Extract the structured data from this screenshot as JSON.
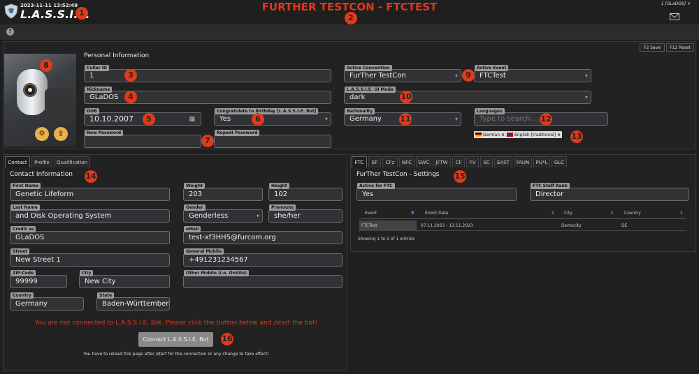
{
  "header": {
    "timestamp": "2023-11-11 13:52:49",
    "logo_text": "L.A.S.S.I.E.",
    "title": "FURTHER TESTCON - FTCTEST",
    "user": "1 [GLaDOS]",
    "logout_glyph": "×"
  },
  "toolbar": {
    "help": "?",
    "save": "F2 Save",
    "reset": "F12 Reset"
  },
  "personal": {
    "heading": "Personal Information",
    "collar_id": {
      "label": "Collar ID",
      "value": "1"
    },
    "nickname": {
      "label": "Nickname",
      "value": "GLaDOS"
    },
    "dob": {
      "label": "DOB",
      "value": "10.10.2007"
    },
    "birthday": {
      "label": "Congratulate to birthday [L.A.S.S.I.E. Bot]",
      "value": "Yes"
    },
    "new_password": {
      "label": "New Password",
      "value": ""
    },
    "repeat_password": {
      "label": "Repeat Password",
      "value": ""
    },
    "active_convention": {
      "label": "Active Convention",
      "value": "FurTher TestCon"
    },
    "active_event": {
      "label": "Active Event",
      "value": "FTCTest"
    },
    "ui_mode": {
      "label": "L.A.S.S.I.E. UI Mode",
      "value": "dark"
    },
    "nationality": {
      "label": "Nationality",
      "value": "Germany"
    },
    "languages": {
      "label": "Languages",
      "placeholder": "Type to search ...",
      "tags": [
        "German",
        "English [traditional]"
      ],
      "remove_glyph": "×"
    }
  },
  "contact": {
    "tabs": [
      "Contact",
      "Profile",
      "Qualification"
    ],
    "heading": "Contact Information",
    "first_name": {
      "label": "First Name",
      "value": "Genetic Lifeform"
    },
    "weight": {
      "label": "Weight",
      "value": "203"
    },
    "height": {
      "label": "Height",
      "value": "102"
    },
    "last_name": {
      "label": "Last Name",
      "value": "and Disk Operating System"
    },
    "gender": {
      "label": "Gender",
      "value": "Genderless"
    },
    "pronouns": {
      "label": "Pronouns",
      "value": "she/her"
    },
    "credit_as": {
      "label": "Credit as",
      "value": "GLaDOS"
    },
    "email": {
      "label": "eMail",
      "value": "test-xf3HH5@furcom.org"
    },
    "street": {
      "label": "Street",
      "value": "New Street 1"
    },
    "mobile": {
      "label": "General Mobile",
      "value": "+491231234567"
    },
    "zip": {
      "label": "ZIP-Code",
      "value": "99999"
    },
    "city": {
      "label": "City",
      "value": "New City"
    },
    "other_mobile": {
      "label": "Other Mobile (i.e. OnSite)",
      "value": ""
    },
    "country": {
      "label": "Country",
      "value": "Germany"
    },
    "state": {
      "label": "State",
      "value": "Baden-Württemberg"
    },
    "bot_warning": "You are not connected to L.A.S.S.I.E. Bot. Please click the button below and /start the bot!",
    "bot_button": "Connect L.A.S.S.I.E. Bot",
    "bot_note": "You have to reload this page after /start for the connection or any change to take effect!"
  },
  "convention": {
    "tabs": [
      "FTC",
      "EF",
      "CFz",
      "NFC",
      "SWC",
      "JFTW",
      "CF",
      "FV",
      "SC",
      "EAST",
      "FAUN",
      "PU*L",
      "GLC"
    ],
    "heading": "FurTher TestCon - Settings",
    "active_for": {
      "label": "Active for FTC",
      "value": "Yes"
    },
    "staff_rank": {
      "label": "FTC Staff Rank",
      "value": "Director"
    },
    "table": {
      "headers": [
        "Event",
        "Event Date",
        "City",
        "Country"
      ],
      "rows": [
        [
          "FTCTest",
          "07.11.2023 - 13.11.2023",
          "Democity",
          "DE"
        ]
      ],
      "footer": "Showing 1 to 1 of 1 entries"
    }
  },
  "badges": [
    "1",
    "2",
    "3",
    "4",
    "5",
    "6",
    "7",
    "8",
    "9",
    "10",
    "11",
    "12",
    "13",
    "14",
    "15",
    "16"
  ],
  "colors": {
    "accent": "#e03a1a",
    "background": "#1f1f1f",
    "field": "#303236"
  }
}
